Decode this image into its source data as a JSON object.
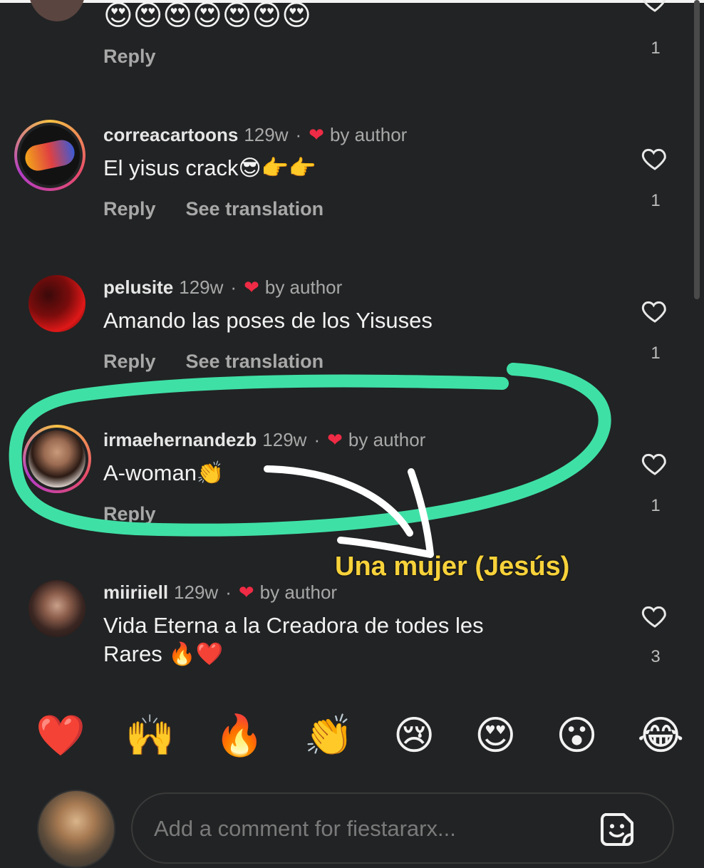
{
  "top_partial": {
    "emojis": "😍😍😍😍😍😍😍",
    "reply_label": "Reply",
    "like_count": "1"
  },
  "comments": [
    {
      "username": "correacartoons",
      "time": "129w",
      "dot": "·",
      "liked_by": "by author",
      "text": "El yisus crack😎👉👉",
      "reply_label": "Reply",
      "translate_label": "See translation",
      "like_count": "1"
    },
    {
      "username": "pelusite",
      "time": "129w",
      "dot": "·",
      "liked_by": "by author",
      "text": "Amando las poses de los Yisuses",
      "reply_label": "Reply",
      "translate_label": "See translation",
      "like_count": "1"
    },
    {
      "username": "irmaehernandezb",
      "time": "129w",
      "dot": "·",
      "liked_by": "by author",
      "text": "A-woman👏",
      "reply_label": "Reply",
      "like_count": "1"
    },
    {
      "username": "miiriiell",
      "time": "129w",
      "dot": "·",
      "liked_by": "by author",
      "text_line1": "Vida Eterna a la Creadora de todes les",
      "text_line2": "Rares 🔥❤️",
      "like_count": "3"
    }
  ],
  "annotation": {
    "text": "Una mujer (Jesús)",
    "highlight_color": "#3fe0a6",
    "text_color": "#f7d23a"
  },
  "reactions": [
    "❤️",
    "🙌",
    "🔥",
    "👏",
    "😢",
    "😍",
    "😮",
    "😂"
  ],
  "composer": {
    "placeholder": "Add a comment for fiestararx..."
  },
  "colors": {
    "background": "#222324",
    "liked_heart": "#ef2b45",
    "secondary_text": "#a8a8a8"
  },
  "icons": {
    "like": "heart-outline-icon",
    "author_like": "red-heart-icon",
    "sticker": "sticker-icon"
  }
}
